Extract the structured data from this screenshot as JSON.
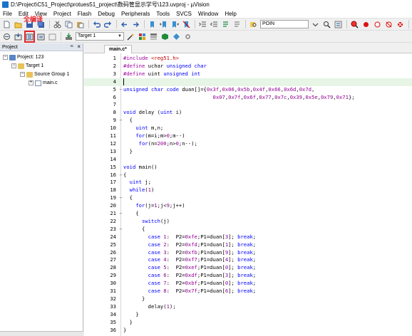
{
  "window": {
    "title": "D:\\Project\\C51_Project\\protues51_project\\数码管显示学号\\123.uvproj - µVision"
  },
  "menu": {
    "items": [
      "File",
      "Edit",
      "View",
      "Project",
      "Flash",
      "Debug",
      "Peripherals",
      "Tools",
      "SVCS",
      "Window",
      "Help"
    ]
  },
  "toolbar": {
    "find_text": "POIN",
    "target_label": "Target 1",
    "callout": "全编译"
  },
  "project_panel": {
    "title": "Project",
    "pin_symbol": "ꟹ",
    "close_symbol": "×",
    "tree": [
      {
        "label": "Project: 123",
        "exp": "−"
      },
      {
        "label": "Target 1",
        "exp": "−"
      },
      {
        "label": "Source Group 1",
        "exp": "−"
      },
      {
        "label": "main.c",
        "exp": "+"
      }
    ]
  },
  "editor": {
    "tab_label": "main.c*",
    "lines": [
      {
        "n": "1",
        "fold": "",
        "code": "#include <reg51.h>"
      },
      {
        "n": "2",
        "fold": "",
        "code": "#define uchar unsigned char"
      },
      {
        "n": "3",
        "fold": "",
        "code": "#define uint unsigned int"
      },
      {
        "n": "4",
        "fold": "",
        "code": ""
      },
      {
        "n": "5",
        "fold": "−",
        "code": "unsigned char code duan[]={0x3f,0x06,0x5b,0x4f,0x66,0x6d,0x7d,"
      },
      {
        "n": "6",
        "fold": "",
        "code": "                             0x07,0x7f,0x6f,0x77,0x7c,0x39,0x5e,0x79,0x71};"
      },
      {
        "n": "7",
        "fold": "",
        "code": ""
      },
      {
        "n": "8",
        "fold": "",
        "code": "void delay (uint i)"
      },
      {
        "n": "9",
        "fold": "−",
        "code": "  {"
      },
      {
        "n": "10",
        "fold": "",
        "code": "    uint m,n;"
      },
      {
        "n": "11",
        "fold": "",
        "code": "    for(m=i;m>0;m--)"
      },
      {
        "n": "12",
        "fold": "",
        "code": "     for(n=200;n>0;n--);"
      },
      {
        "n": "13",
        "fold": "",
        "code": "  }"
      },
      {
        "n": "14",
        "fold": "",
        "code": ""
      },
      {
        "n": "15",
        "fold": "",
        "code": "void main()"
      },
      {
        "n": "16",
        "fold": "−",
        "code": "{"
      },
      {
        "n": "17",
        "fold": "",
        "code": "  uint j;"
      },
      {
        "n": "18",
        "fold": "",
        "code": "  while(1)"
      },
      {
        "n": "19",
        "fold": "−",
        "code": "  {"
      },
      {
        "n": "20",
        "fold": "",
        "code": "    for(j=1;j<9;j++)"
      },
      {
        "n": "21",
        "fold": "−",
        "code": "    {"
      },
      {
        "n": "22",
        "fold": "",
        "code": "      switch(j)"
      },
      {
        "n": "23",
        "fold": "−",
        "code": "      {"
      },
      {
        "n": "24",
        "fold": "",
        "code": "        case 1:  P2=0xfe;P1=duan[3]; break;"
      },
      {
        "n": "25",
        "fold": "",
        "code": "        case 2:  P2=0xfd;P1=duan[1]; break;"
      },
      {
        "n": "26",
        "fold": "",
        "code": "        case 3:  P2=0xfb;P1=duan[9]; break;"
      },
      {
        "n": "27",
        "fold": "",
        "code": "        case 4:  P2=0xf7;P1=duan[4]; break;"
      },
      {
        "n": "28",
        "fold": "",
        "code": "        case 5:  P2=0xef;P1=duan[0]; break;"
      },
      {
        "n": "29",
        "fold": "",
        "code": "        case 6:  P2=0xdf;P1=duan[3]; break;"
      },
      {
        "n": "30",
        "fold": "",
        "code": "        case 7:  P2=0xbf;P1=duan[0]; break;"
      },
      {
        "n": "31",
        "fold": "",
        "code": "        case 8:  P2=0x7f;P1=duan[6]; break;"
      },
      {
        "n": "32",
        "fold": "",
        "code": "      }"
      },
      {
        "n": "33",
        "fold": "",
        "code": "        delay(1);"
      },
      {
        "n": "34",
        "fold": "",
        "code": "    }"
      },
      {
        "n": "35",
        "fold": "",
        "code": "  }"
      },
      {
        "n": "36",
        "fold": "",
        "code": "}"
      }
    ]
  },
  "colors": {
    "keyword": "#0000ff",
    "preprocessor": "#a000a0",
    "number": "#900090",
    "highlight": "#e3262b",
    "active_line": "#e6f5e6"
  }
}
